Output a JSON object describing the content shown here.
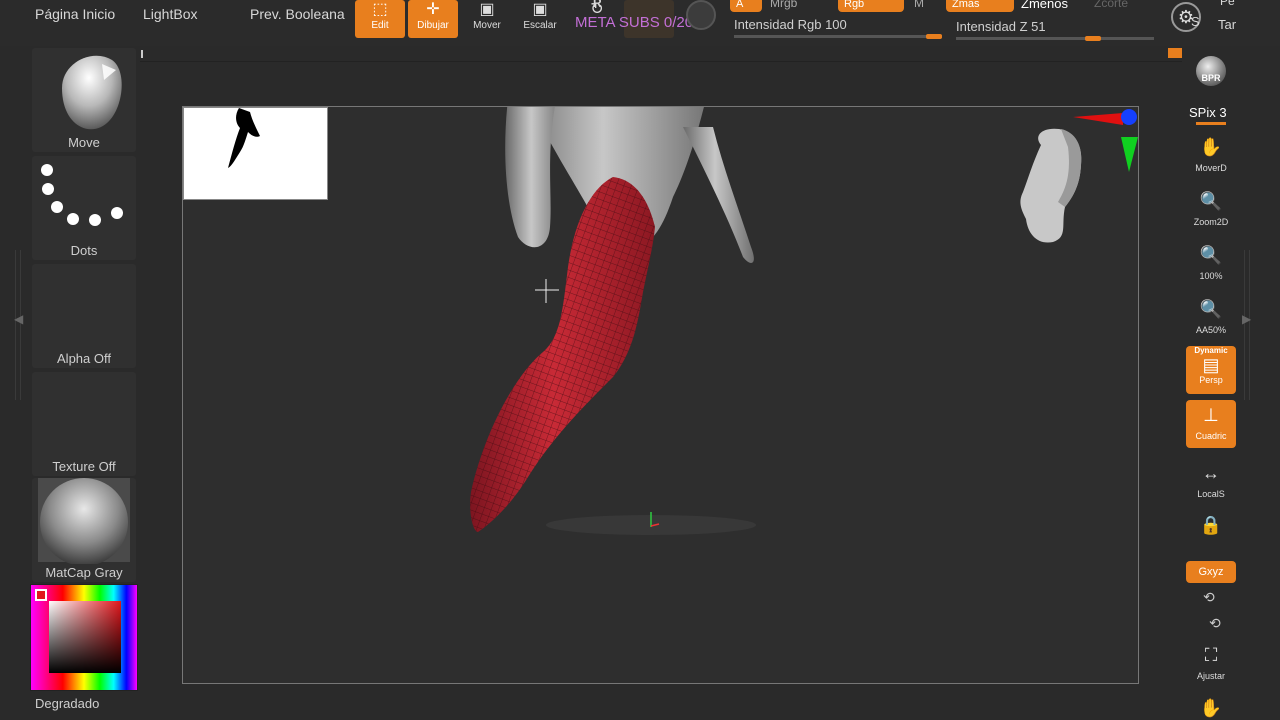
{
  "topbar": {
    "home_label": "Página Inicio",
    "lightbox_label": "LightBox",
    "bool_label": "Prev. Booleana",
    "edit_label": "Edit",
    "draw_label": "Dibujar",
    "move_label": "Mover",
    "scale_label": "Escalar",
    "rotate_letter": "R",
    "meta_subs": "META SUBS 0/20",
    "a_tab": "A",
    "mrgb_label": "Mrgb",
    "rgb_label": "Rgb",
    "m_label": "M",
    "zmas_label": "Zmas",
    "zmenos_label": "Zmenos",
    "zcorte_label": "Zcorte",
    "rgb_intensity_label": "Intensidad Rgb 100",
    "z_intensity_label": "Intensidad Z 51",
    "far_right_top": "Pe",
    "far_right_bottom": "Tar",
    "s_label": "S"
  },
  "left_tray": {
    "brush_label": "Move",
    "stroke_label": "Dots",
    "alpha_label": "Alpha Off",
    "texture_label": "Texture Off",
    "material_label": "MatCap Gray",
    "gradient_label": "Degradado"
  },
  "right_shelf": {
    "bpr_label": "BPR",
    "spix_label": "SPix 3",
    "move_label": "MoverD",
    "zoom_label": "Zoom2D",
    "actual_label": "100%",
    "aahalf_label": "AA50%",
    "persp_top": "Dynamic",
    "persp_label": "Persp",
    "floor_label": "Cuadric",
    "local_label": "LocalS",
    "xyz_label": "Gxyz",
    "frame_label": "Ajustar"
  },
  "colors": {
    "accent": "#e87f1e",
    "model_red": "#b3232f",
    "meta_subs_text": "#c36fd6"
  },
  "icons": {
    "edit": "edit-icon",
    "draw": "draw-icon",
    "move": "move-icon",
    "scale": "scale-icon",
    "rotate": "rotate-icon"
  }
}
